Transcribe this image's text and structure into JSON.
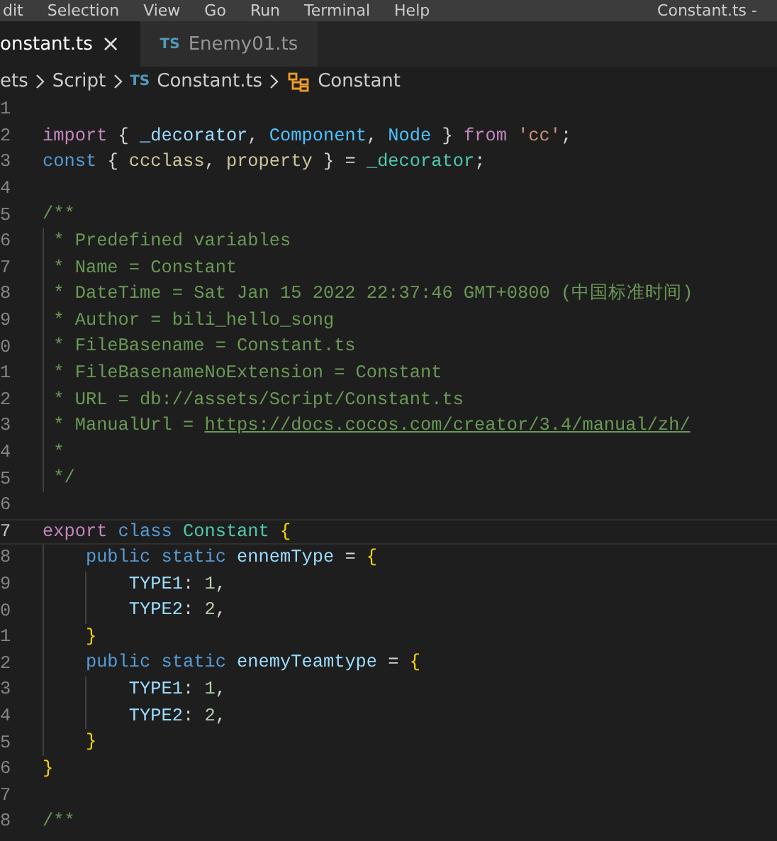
{
  "menu_bar": {
    "items": [
      "dit",
      "Selection",
      "View",
      "Go",
      "Run",
      "Terminal",
      "Help"
    ],
    "title": "Constant.ts -"
  },
  "tabs": [
    {
      "label": "onstant.ts",
      "selected": true,
      "close": "×"
    },
    {
      "label": "Enemy01.ts",
      "badge": "TS",
      "selected": false
    }
  ],
  "breadcrumb": [
    {
      "label": "ets",
      "kind": "folder"
    },
    {
      "label": "Script",
      "kind": "folder"
    },
    {
      "label": "Constant.ts",
      "kind": "file",
      "badge": "TS"
    },
    {
      "label": "Constant",
      "kind": "class"
    }
  ],
  "editor": {
    "lines": [
      {
        "number": "1",
        "current": false
      },
      {
        "number": "2",
        "current": false,
        "tokens": [
          {
            "text": "import",
            "kind": "keyword"
          },
          {
            "text": " { ",
            "kind": "punct"
          },
          {
            "text": "_decorator",
            "kind": "var"
          },
          {
            "text": ", ",
            "kind": "plain"
          },
          {
            "text": "Component",
            "kind": "type"
          },
          {
            "text": ", ",
            "kind": "plain"
          },
          {
            "text": "Node",
            "kind": "type"
          },
          {
            "text": " } ",
            "kind": "punct"
          },
          {
            "text": "from",
            "kind": "keyword"
          },
          {
            "text": " 'cc'",
            "kind": "str"
          },
          {
            "text": ";",
            "kind": "plain"
          }
        ]
      },
      {
        "number": "3",
        "current": false,
        "tokens": [
          {
            "text": "const",
            "kind": "storage"
          },
          {
            "text": " { ",
            "kind": "punct"
          },
          {
            "text": "ccclass",
            "kind": "param"
          },
          {
            "text": ", ",
            "kind": "plain"
          },
          {
            "text": "property",
            "kind": "param"
          },
          {
            "text": " } = ",
            "kind": "punct"
          },
          {
            "text": "_decorator",
            "kind": "cls"
          },
          {
            "text": ";",
            "kind": "plain"
          }
        ]
      },
      {
        "number": "4",
        "current": false
      },
      {
        "number": "5",
        "current": false,
        "tokens": [
          {
            "text": "/**",
            "kind": "comment"
          }
        ]
      },
      {
        "number": "6",
        "current": false,
        "tokens": [
          {
            "text": " * Predefined variables",
            "kind": "comment"
          }
        ]
      },
      {
        "number": "7",
        "current": false,
        "tokens": [
          {
            "text": " * Name = Constant",
            "kind": "comment"
          }
        ]
      },
      {
        "number": "8",
        "current": false,
        "tokens": [
          {
            "text": " * DateTime = Sat Jan 15 2022 22:37:46 GMT+0800 (中国标准时间)",
            "kind": "comment"
          }
        ]
      },
      {
        "number": "9",
        "current": false,
        "tokens": [
          {
            "text": " * Author = bili_hello_song",
            "kind": "comment"
          }
        ]
      },
      {
        "number": "0",
        "current": false,
        "tokens": [
          {
            "text": " * FileBasename = Constant.ts",
            "kind": "comment"
          }
        ]
      },
      {
        "number": "1",
        "current": false,
        "tokens": [
          {
            "text": " * FileBasenameNoExtension = Constant",
            "kind": "comment"
          }
        ]
      },
      {
        "number": "2",
        "current": false,
        "tokens": [
          {
            "text": " * URL = db://assets/Script/Constant.ts",
            "kind": "comment"
          }
        ]
      },
      {
        "number": "3",
        "current": false,
        "tokens": [
          {
            "text": " * ManualUrl = ",
            "kind": "comment"
          },
          {
            "text": "https://docs.cocos.com/creator/3.4/manual/zh/",
            "kind": "link"
          }
        ]
      },
      {
        "number": "4",
        "current": false,
        "tokens": [
          {
            "text": " *",
            "kind": "comment"
          }
        ]
      },
      {
        "number": "5",
        "current": false,
        "tokens": [
          {
            "text": " */",
            "kind": "comment"
          }
        ]
      },
      {
        "number": "6",
        "current": false
      },
      {
        "number": "7",
        "current": true,
        "tokens": [
          {
            "text": "export",
            "kind": "keyword"
          },
          {
            "text": " class",
            "kind": "storage"
          },
          {
            "text": " Constant",
            "kind": "cls"
          },
          {
            "text": " {",
            "kind": "bracket"
          }
        ]
      },
      {
        "number": "8",
        "current": false,
        "tokens": [
          {
            "text": "    public static",
            "kind": "storage"
          },
          {
            "text": " ennemType",
            "kind": "prop"
          },
          {
            "text": " = ",
            "kind": "plain"
          },
          {
            "text": "{",
            "kind": "bracket2"
          }
        ]
      },
      {
        "number": "9",
        "current": false,
        "tokens": [
          {
            "text": "        TYPE1",
            "kind": "prop"
          },
          {
            "text": ": ",
            "kind": "plain"
          },
          {
            "text": "1",
            "kind": "num"
          },
          {
            "text": ",",
            "kind": "plain"
          }
        ]
      },
      {
        "number": "0",
        "current": false,
        "tokens": [
          {
            "text": "        TYPE2",
            "kind": "prop"
          },
          {
            "text": ": ",
            "kind": "plain"
          },
          {
            "text": "2",
            "kind": "num"
          },
          {
            "text": ",",
            "kind": "plain"
          }
        ]
      },
      {
        "number": "1",
        "current": false,
        "tokens": [
          {
            "text": "    }",
            "kind": "bracket2"
          }
        ]
      },
      {
        "number": "2",
        "current": false,
        "tokens": [
          {
            "text": "    public static",
            "kind": "storage"
          },
          {
            "text": " enemyTeamtype",
            "kind": "prop"
          },
          {
            "text": " = ",
            "kind": "plain"
          },
          {
            "text": "{",
            "kind": "bracket2"
          }
        ]
      },
      {
        "number": "3",
        "current": false,
        "tokens": [
          {
            "text": "        TYPE1",
            "kind": "prop"
          },
          {
            "text": ": ",
            "kind": "plain"
          },
          {
            "text": "1",
            "kind": "num"
          },
          {
            "text": ",",
            "kind": "plain"
          }
        ]
      },
      {
        "number": "4",
        "current": false,
        "tokens": [
          {
            "text": "        TYPE2",
            "kind": "prop"
          },
          {
            "text": ": ",
            "kind": "plain"
          },
          {
            "text": "2",
            "kind": "num"
          },
          {
            "text": ",",
            "kind": "plain"
          }
        ]
      },
      {
        "number": "5",
        "current": false,
        "tokens": [
          {
            "text": "    }",
            "kind": "bracket2"
          }
        ]
      },
      {
        "number": "6",
        "current": false,
        "tokens": [
          {
            "text": "}",
            "kind": "bracket"
          }
        ]
      },
      {
        "number": "7",
        "current": false
      },
      {
        "number": "8",
        "current": false,
        "tokens": [
          {
            "text": "/**",
            "kind": "comment"
          }
        ]
      }
    ]
  }
}
